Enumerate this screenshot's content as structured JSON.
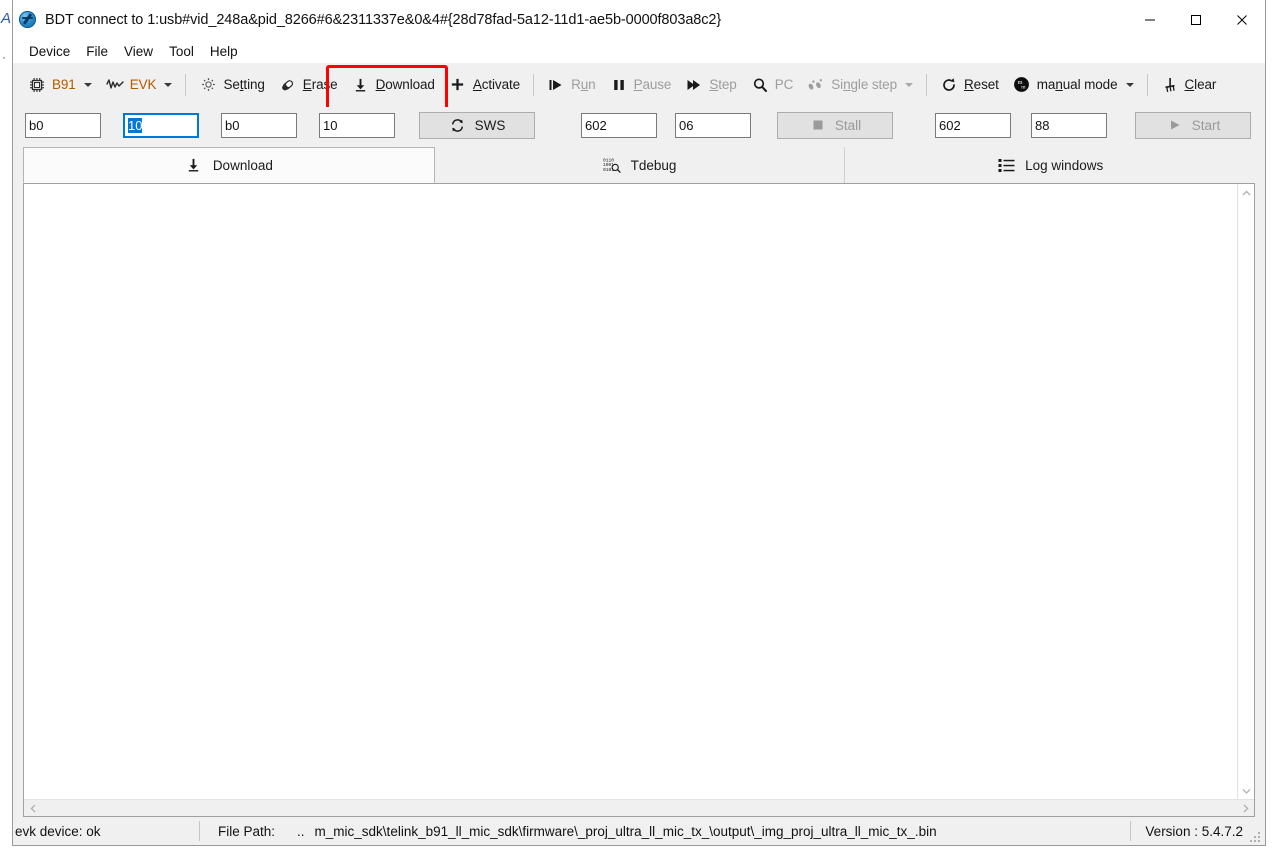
{
  "window": {
    "title": "BDT connect to 1:usb#vid_248a&pid_8266#6&2311337e&0&4#{28d78fad-5a12-11d1-ae5b-0000f803a8c2}",
    "icon": "bdt-app-icon",
    "controls": {
      "minimize": "minimize-icon",
      "maximize": "maximize-icon",
      "close": "close-icon"
    }
  },
  "backdrop": {
    "artifact_1": "A",
    "artifact_2": "·"
  },
  "menu": {
    "items": [
      {
        "label": "Device"
      },
      {
        "label": "File"
      },
      {
        "label": "View"
      },
      {
        "label": "Tool"
      },
      {
        "label": "Help"
      }
    ]
  },
  "toolbar": {
    "highlight_color": "#ff0000",
    "items": [
      {
        "label": "B91",
        "icon": "chip-icon",
        "accent": true,
        "dropdown": true,
        "disabled": false
      },
      {
        "label": "EVK",
        "icon": "waveform-icon",
        "accent": true,
        "dropdown": true,
        "disabled": false
      },
      {
        "label": "Setting",
        "icon": "gear-icon",
        "accent": false,
        "dropdown": false,
        "disabled": false
      },
      {
        "label": "Erase",
        "icon": "eraser-icon",
        "accent": false,
        "dropdown": false,
        "disabled": false
      },
      {
        "label": "Download",
        "icon": "download-icon",
        "accent": false,
        "dropdown": false,
        "disabled": false
      },
      {
        "label": "Activate",
        "icon": "plus-icon",
        "accent": false,
        "dropdown": false,
        "disabled": false
      },
      {
        "label": "Run",
        "icon": "run-icon",
        "accent": false,
        "dropdown": false,
        "disabled": true
      },
      {
        "label": "Pause",
        "icon": "pause-icon",
        "accent": false,
        "dropdown": false,
        "disabled": true
      },
      {
        "label": "Step",
        "icon": "step-icon",
        "accent": false,
        "dropdown": false,
        "disabled": true
      },
      {
        "label": "PC",
        "icon": "magnifier-icon",
        "accent": false,
        "dropdown": false,
        "disabled": true
      },
      {
        "label": "Single step",
        "icon": "footsteps-icon",
        "accent": false,
        "dropdown": true,
        "disabled": true
      },
      {
        "label": "Reset",
        "icon": "reset-icon",
        "accent": false,
        "dropdown": false,
        "disabled": false
      },
      {
        "label": "manual mode",
        "icon": "manual-mode-icon",
        "accent": false,
        "dropdown": true,
        "disabled": false
      },
      {
        "label": "Clear",
        "icon": "rake-icon",
        "accent": false,
        "dropdown": false,
        "disabled": false
      }
    ]
  },
  "fields": {
    "addr1": {
      "value": "b0",
      "placeholder": ""
    },
    "len1": {
      "value": "10",
      "placeholder": "",
      "focused": true,
      "selected": true
    },
    "addr2": {
      "value": "b0",
      "placeholder": ""
    },
    "len2": {
      "value": "10",
      "placeholder": ""
    },
    "sws_button": {
      "label": "SWS",
      "icon": "refresh-icon",
      "disabled": false
    },
    "stall_addr": {
      "value": "602",
      "placeholder": ""
    },
    "stall_val": {
      "value": "06",
      "placeholder": ""
    },
    "stall_button": {
      "label": "Stall",
      "icon": "stop-icon",
      "disabled": true
    },
    "start_addr": {
      "value": "602",
      "placeholder": ""
    },
    "start_val": {
      "value": "88",
      "placeholder": ""
    },
    "start_button": {
      "label": "Start",
      "icon": "play-icon",
      "disabled": true
    }
  },
  "tabs": [
    {
      "label": "Download",
      "icon": "download-icon",
      "active": true
    },
    {
      "label": "Tdebug",
      "icon": "binary-search-icon",
      "active": false
    },
    {
      "label": "Log windows",
      "icon": "list-icon",
      "active": false
    }
  ],
  "content": {
    "text": "",
    "vscroll": {
      "up": "chevron-up-icon",
      "down": "chevron-down-icon"
    },
    "hscroll": {
      "left": "chevron-left-icon",
      "right": "chevron-right-icon"
    }
  },
  "status": {
    "device_state": "evk device: ok",
    "file_path_label": "File Path:",
    "file_path_prefix": "..",
    "file_path_value": "m_mic_sdk\\telink_b91_ll_mic_sdk\\firmware\\_proj_ultra_ll_mic_tx_\\output\\_img_proj_ultra_ll_mic_tx_.bin",
    "version": "Version : 5.4.7.2"
  }
}
